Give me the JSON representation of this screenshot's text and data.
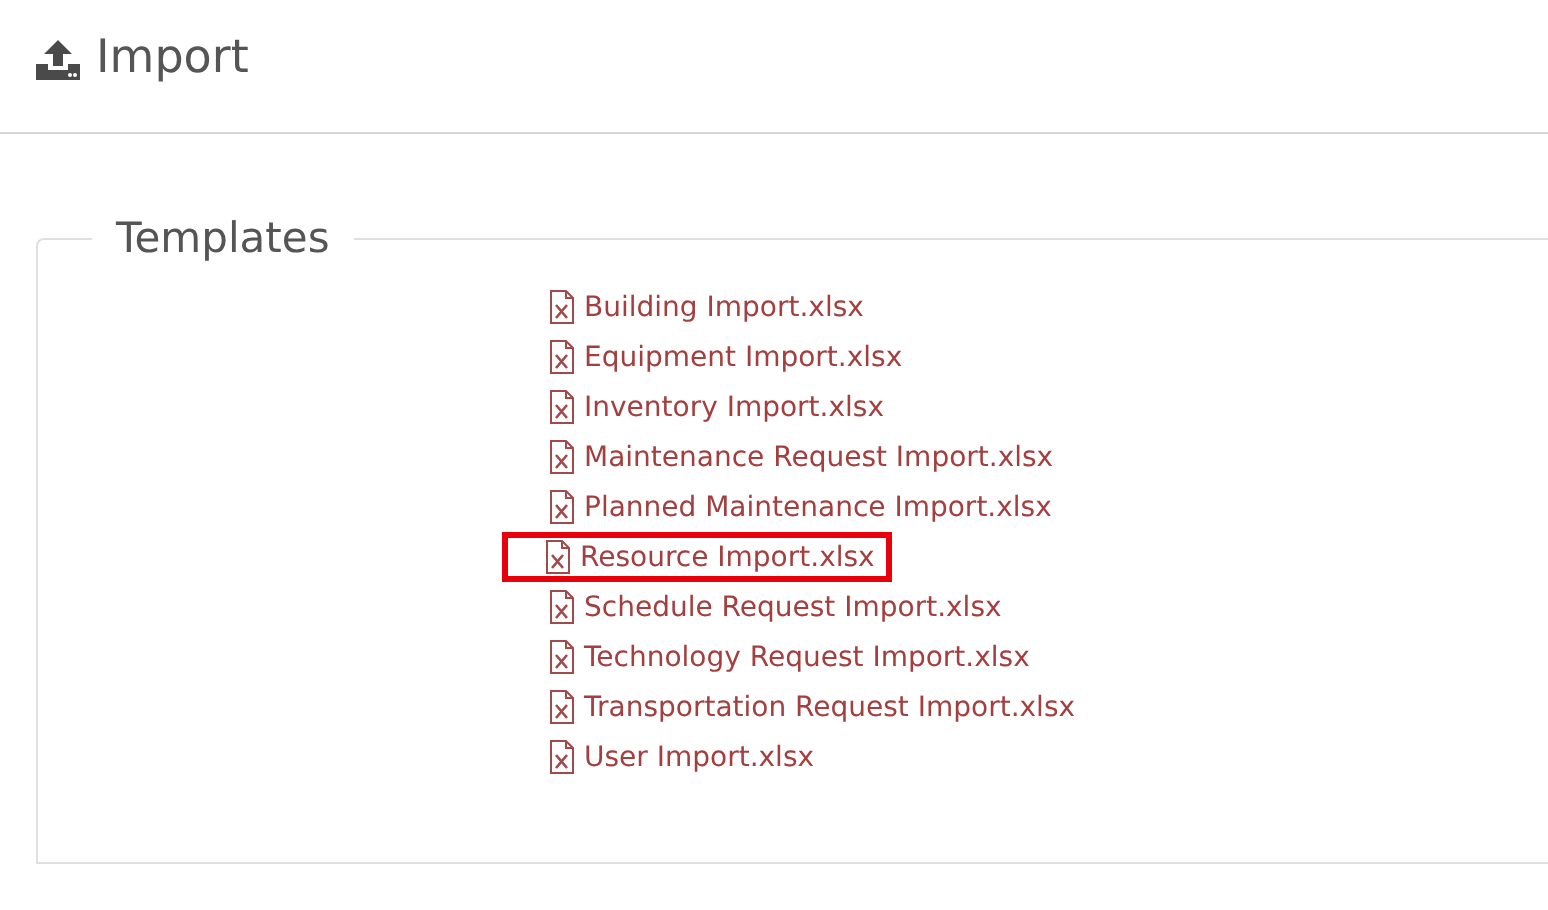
{
  "header": {
    "title": "Import"
  },
  "templates": {
    "legend": "Templates",
    "files": [
      {
        "name": "Building Import.xlsx",
        "highlighted": false
      },
      {
        "name": "Equipment Import.xlsx",
        "highlighted": false
      },
      {
        "name": "Inventory Import.xlsx",
        "highlighted": false
      },
      {
        "name": "Maintenance Request Import.xlsx",
        "highlighted": false
      },
      {
        "name": "Planned Maintenance Import.xlsx",
        "highlighted": false
      },
      {
        "name": "Resource Import.xlsx",
        "highlighted": true
      },
      {
        "name": "Schedule Request Import.xlsx",
        "highlighted": false
      },
      {
        "name": "Technology Request Import.xlsx",
        "highlighted": false
      },
      {
        "name": "Transportation Request Import.xlsx",
        "highlighted": false
      },
      {
        "name": "User Import.xlsx",
        "highlighted": false
      }
    ]
  }
}
